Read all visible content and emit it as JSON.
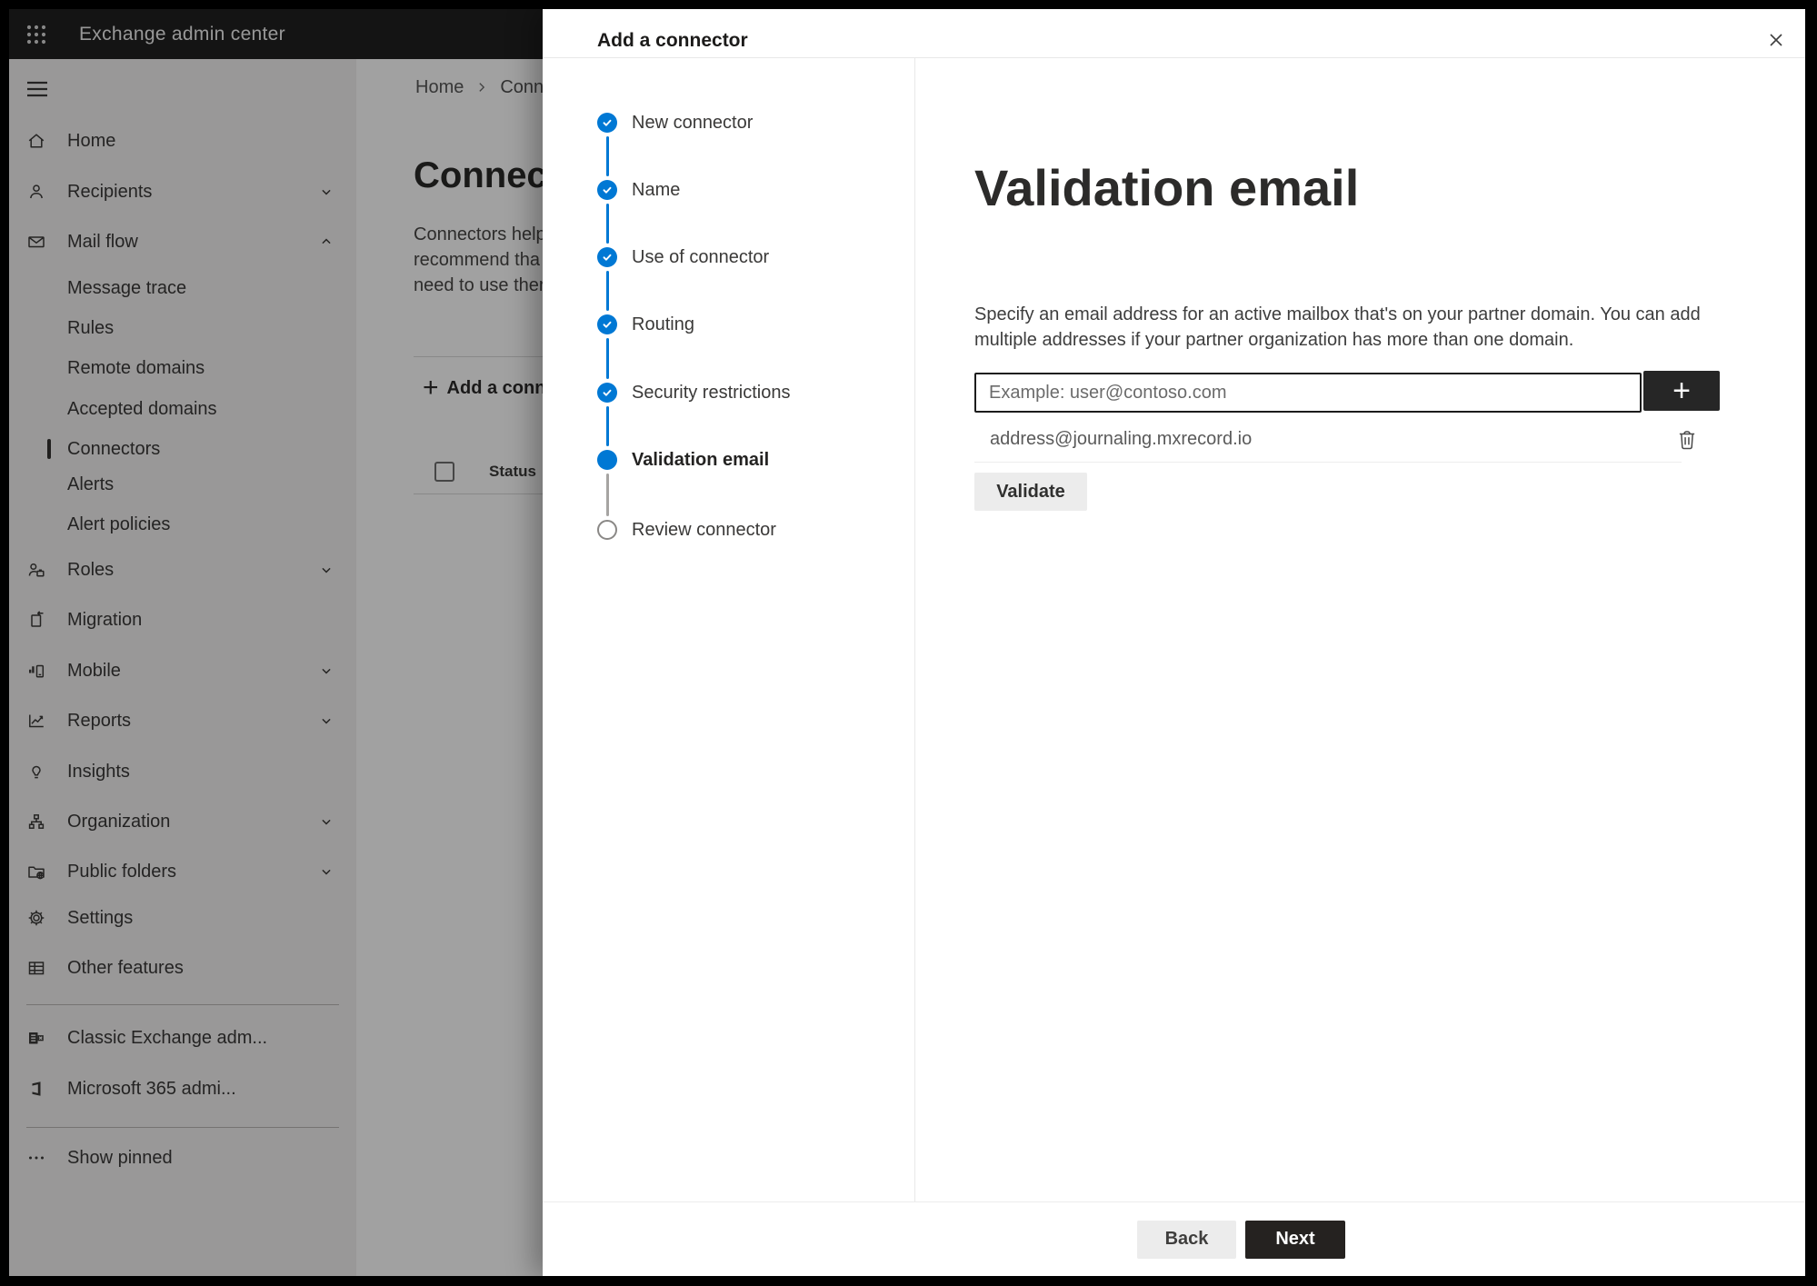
{
  "colors": {
    "accent": "#0078d4",
    "topbar-bg": "#202020",
    "sidebar-bg": "#f3f2f1",
    "dark-button": "#252220",
    "plus-button": "#262626",
    "input-border": "#1c1c1c",
    "light-button": "#ececec",
    "step-pending": "#8a8886"
  },
  "topbar": {
    "app_title": "Exchange admin center"
  },
  "sidebar": {
    "items": [
      {
        "label": "Home"
      },
      {
        "label": "Recipients"
      },
      {
        "label": "Mail flow"
      },
      {
        "label": "Message trace"
      },
      {
        "label": "Rules"
      },
      {
        "label": "Remote domains"
      },
      {
        "label": "Accepted domains"
      },
      {
        "label": "Connectors"
      },
      {
        "label": "Alerts"
      },
      {
        "label": "Alert policies"
      },
      {
        "label": "Roles"
      },
      {
        "label": "Migration"
      },
      {
        "label": "Mobile"
      },
      {
        "label": "Reports"
      },
      {
        "label": "Insights"
      },
      {
        "label": "Organization"
      },
      {
        "label": "Public folders"
      },
      {
        "label": "Settings"
      },
      {
        "label": "Other features"
      },
      {
        "label": "Classic Exchange adm..."
      },
      {
        "label": "Microsoft 365 admi..."
      },
      {
        "label": "Show pinned"
      }
    ]
  },
  "page": {
    "breadcrumb": {
      "home": "Home",
      "current": "Conne"
    },
    "title": "Connec",
    "description_lines": [
      "Connectors help",
      "recommend tha",
      "need to use ther"
    ],
    "toolbar": {
      "add_label": "Add a conn"
    },
    "table": {
      "status_header": "Status"
    }
  },
  "dialog": {
    "title": "Add a connector",
    "steps": [
      {
        "label": "New connector",
        "state": "done"
      },
      {
        "label": "Name",
        "state": "done"
      },
      {
        "label": "Use of connector",
        "state": "done"
      },
      {
        "label": "Routing",
        "state": "done"
      },
      {
        "label": "Security restrictions",
        "state": "done"
      },
      {
        "label": "Validation email",
        "state": "current"
      },
      {
        "label": "Review connector",
        "state": "todo"
      }
    ],
    "content": {
      "heading": "Validation email",
      "description_lines": [
        "Specify an email address for an active mailbox that's on your partner domain. You can add",
        "multiple addresses if your partner organization has more than one domain."
      ],
      "email_placeholder": "Example: user@contoso.com",
      "add_button_label": "+",
      "added_email": "address@journaling.mxrecord.io",
      "validate_label": "Validate"
    },
    "footer": {
      "back_label": "Back",
      "next_label": "Next"
    }
  }
}
